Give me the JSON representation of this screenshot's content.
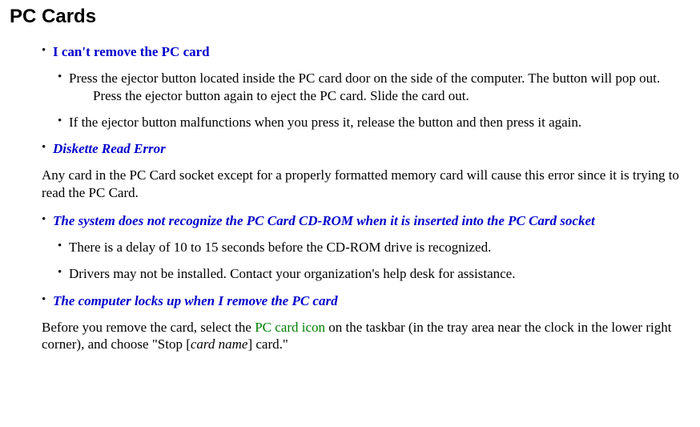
{
  "title": "PC Cards",
  "sections": [
    {
      "heading": "I can't remove the PC card",
      "heading_style": "first",
      "subs": [
        "Press the ejector button located inside the PC card door on the side of the computer. The button will pop out. Press the ejector button again to eject the PC card.  Slide the card out.",
        "If the ejector button malfunctions when you press it, release the button and then press it again."
      ],
      "paras": []
    },
    {
      "heading": "Diskette Read Error",
      "heading_style": "italic",
      "subs": [],
      "paras": [
        {
          "pre": "Any card in the PC Card socket except for a properly formatted memory card will cause this error since it is trying to read the PC Card."
        }
      ]
    },
    {
      "heading": "The system does not recognize the PC Card CD-ROM when it is inserted into the PC Card socket",
      "heading_style": "italic",
      "subs": [
        "There is a delay of 10 to 15 seconds before the CD-ROM drive is recognized.",
        "Drivers may not be installed. Contact your organization's help desk for assistance."
      ],
      "paras": []
    },
    {
      "heading": "The computer locks up when I remove the PC card",
      "heading_style": "italic",
      "subs": [],
      "paras": [
        {
          "pre": "Before you remove the card, select the ",
          "green": "PC card icon",
          "mid": " on the taskbar (in the tray area near the clock in the lower right corner), and choose \"Stop [",
          "italic": "card name",
          "post": "] card.\""
        }
      ]
    }
  ]
}
